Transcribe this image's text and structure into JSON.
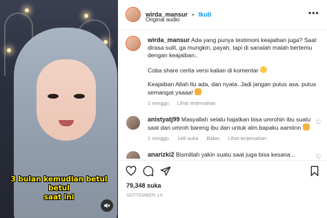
{
  "media": {
    "caption_line1": "3 bulan kemudian betul betul",
    "caption_line2": "saat ini",
    "mute_icon": "speaker-muted-icon"
  },
  "header": {
    "username": "wirda_mansur",
    "separator": "•",
    "follow_label": "Ikuti",
    "subtitle": "Original audio",
    "more_icon": "more-dots-icon"
  },
  "post": {
    "username": "wirda_mansur",
    "paragraph1": "Ada yang punya testimoni keajaiban juga? Saat dirasa sulit, ga mungkin, payah, tapi di sanalah malah bertemu dengan keajaiban..",
    "paragraph2": "Coba share cerita versi kalian di komentar",
    "paragraph3": "Keajaiban Allah itu ada, dan nyata. Jadi jangan putus asa. putus semangat yaaaa!",
    "time": "1 minggu",
    "see_translation": "Lihat terjemahan"
  },
  "comments": [
    {
      "username": "anistyatj99",
      "text": "Masyallah selalu hajatkan bisa umrohin ibu suatu saat dan umroh bareng ibu dan untuk alm.bapaku aamiinn",
      "time": "1 minggu",
      "likes": "149 suka",
      "reply": "Balas",
      "see_translation": "Lihat terjemahan"
    },
    {
      "username": "anarizki2",
      "text": "Bismillah yakin suatu saat juga bisa kesana... aamiin"
    }
  ],
  "actions": {
    "like_icon": "heart-icon",
    "comment_icon": "comment-icon",
    "share_icon": "send-icon",
    "save_icon": "bookmark-icon"
  },
  "likes_count": "79,348 suka",
  "post_date": "SEPTEMBER 19",
  "colors": {
    "link_blue": "#0095f6",
    "text": "#262626",
    "muted": "#8e8e8e",
    "caption_yellow": "#ffe600"
  }
}
